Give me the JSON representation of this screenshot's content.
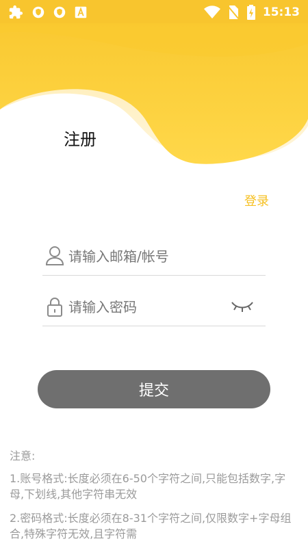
{
  "status_bar": {
    "time": "15:13",
    "left_icons": [
      "puzzle-icon",
      "shield-icon",
      "shield-icon",
      "font-icon"
    ],
    "right_icons": [
      "wifi-icon",
      "no-sim-icon",
      "battery-charging-icon"
    ]
  },
  "page": {
    "title": "注册",
    "login_link": "登录"
  },
  "form": {
    "account_placeholder": "请输入邮箱/帐号",
    "password_placeholder": "请输入密码",
    "submit_label": "提交"
  },
  "notes": {
    "heading": "注意:",
    "rules": [
      "1.账号格式:长度必须在6-50个字符之间,只能包括数字,字母,下划线,其他字符串无效",
      "2.密码格式:长度必须在8-31个字符之间,仅限数字+字母组合,特殊字符无效,且字符需"
    ]
  },
  "colors": {
    "accent": "#f8c52e",
    "link": "#f6c022",
    "button": "#6f6f6f"
  }
}
